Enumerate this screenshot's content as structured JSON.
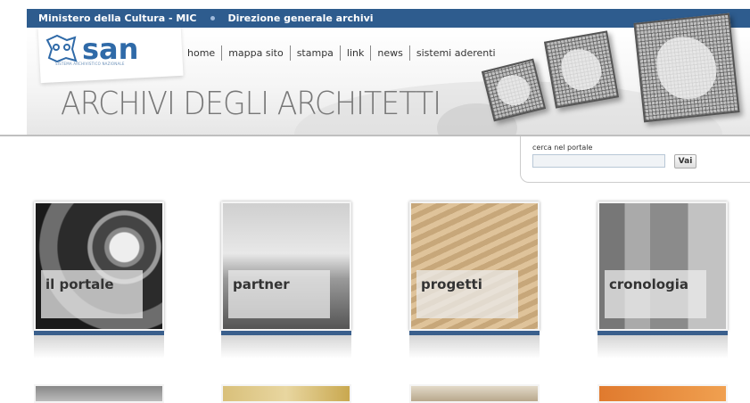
{
  "topbar": {
    "left": "Ministero della Cultura - MIC",
    "right": "Direzione generale archivi"
  },
  "logo": {
    "text": "san",
    "subtitle": "SISTEMA ARCHIVISTICO NAZIONALE"
  },
  "nav": [
    "home",
    "mappa sito",
    "stampa",
    "link",
    "news",
    "sistemi aderenti"
  ],
  "title": "ARCHIVI DEGLI ARCHITETTI",
  "search": {
    "label": "cerca nel portale",
    "value": "",
    "button": "Vai"
  },
  "tiles": [
    {
      "label": "il portale"
    },
    {
      "label": "partner"
    },
    {
      "label": "progetti"
    },
    {
      "label": "cronologia"
    }
  ],
  "colors": {
    "topbar": "#2e5c8e",
    "accent": "#3a5f8c",
    "logo": "#2f6aa8"
  }
}
